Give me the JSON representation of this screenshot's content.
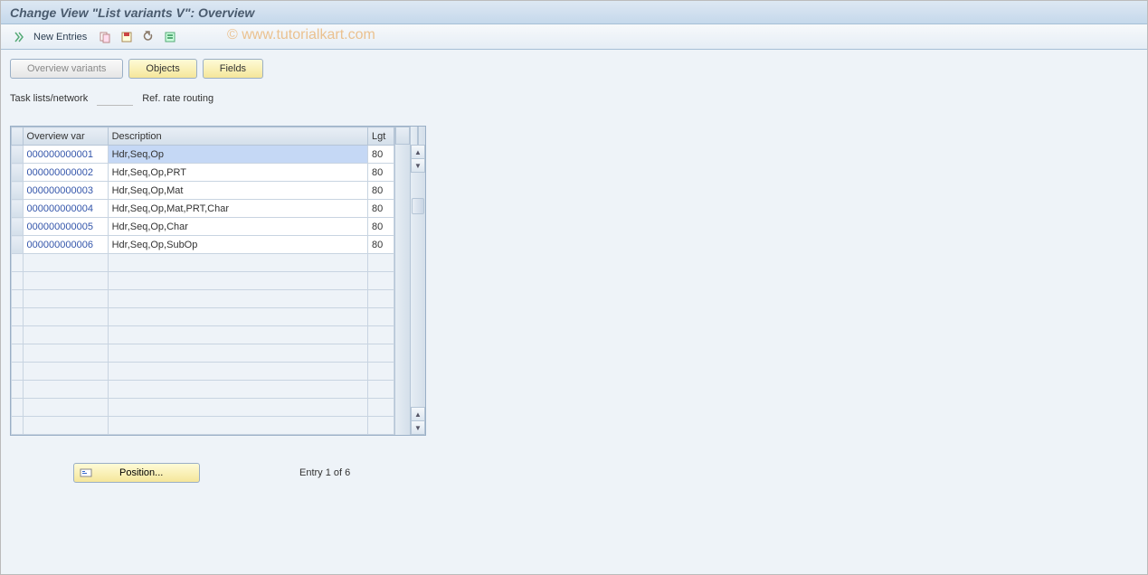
{
  "title": "Change View \"List variants                   V\": Overview",
  "toolbar": {
    "new_entries_label": "New Entries"
  },
  "watermark": "© www.tutorialkart.com",
  "tabs": {
    "overview": "Overview variants",
    "objects": "Objects",
    "fields": "Fields"
  },
  "fields": {
    "task_label": "Task lists/network",
    "task_value": "",
    "ref_label": "Ref. rate routing"
  },
  "table": {
    "headers": {
      "var": "Overview var",
      "desc": "Description",
      "lgt": "Lgt"
    },
    "rows": [
      {
        "var": "000000000001",
        "desc": "Hdr,Seq,Op",
        "lgt": "80"
      },
      {
        "var": "000000000002",
        "desc": "Hdr,Seq,Op,PRT",
        "lgt": "80"
      },
      {
        "var": "000000000003",
        "desc": "Hdr,Seq,Op,Mat",
        "lgt": "80"
      },
      {
        "var": "000000000004",
        "desc": "Hdr,Seq,Op,Mat,PRT,Char",
        "lgt": "80"
      },
      {
        "var": "000000000005",
        "desc": "Hdr,Seq,Op,Char",
        "lgt": "80"
      },
      {
        "var": "000000000006",
        "desc": "Hdr,Seq,Op,SubOp",
        "lgt": "80"
      }
    ],
    "empty_rows": 10
  },
  "footer": {
    "position_label": "Position...",
    "entry_text": "Entry 1 of 6"
  }
}
